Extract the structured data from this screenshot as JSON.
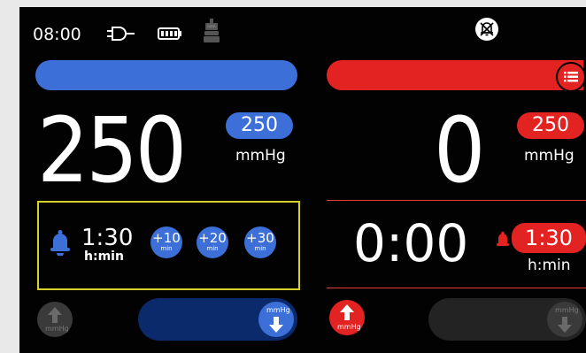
{
  "status": {
    "time": "08:00",
    "icons": [
      "power-plug-icon",
      "battery-icon",
      "cuff-device-icon",
      "alarm-muted-icon"
    ]
  },
  "left": {
    "pressure_value": "250",
    "target_value": "250",
    "unit": "mmHg",
    "timer": {
      "value": "1:30",
      "unit": "h:min"
    },
    "add_buttons": [
      {
        "label": "+10",
        "sub": "min"
      },
      {
        "label": "+20",
        "sub": "min"
      },
      {
        "label": "+30",
        "sub": "min"
      }
    ],
    "deflate_label": "mmHg",
    "inflate_label": "mmHg"
  },
  "right": {
    "pressure_value": "0",
    "target_value": "250",
    "unit": "mmHg",
    "elapsed": "0:00",
    "alarm_time": {
      "value": "1:30",
      "unit": "h:min"
    },
    "inflate_label": "mmHg",
    "deflate_label": "mmHg"
  },
  "colors": {
    "blue": "#3c6fd8",
    "dark_blue": "#0b2a6b",
    "red": "#e32222",
    "alarm_border": "#d7cf2a",
    "disabled": "#3a3a3a"
  }
}
